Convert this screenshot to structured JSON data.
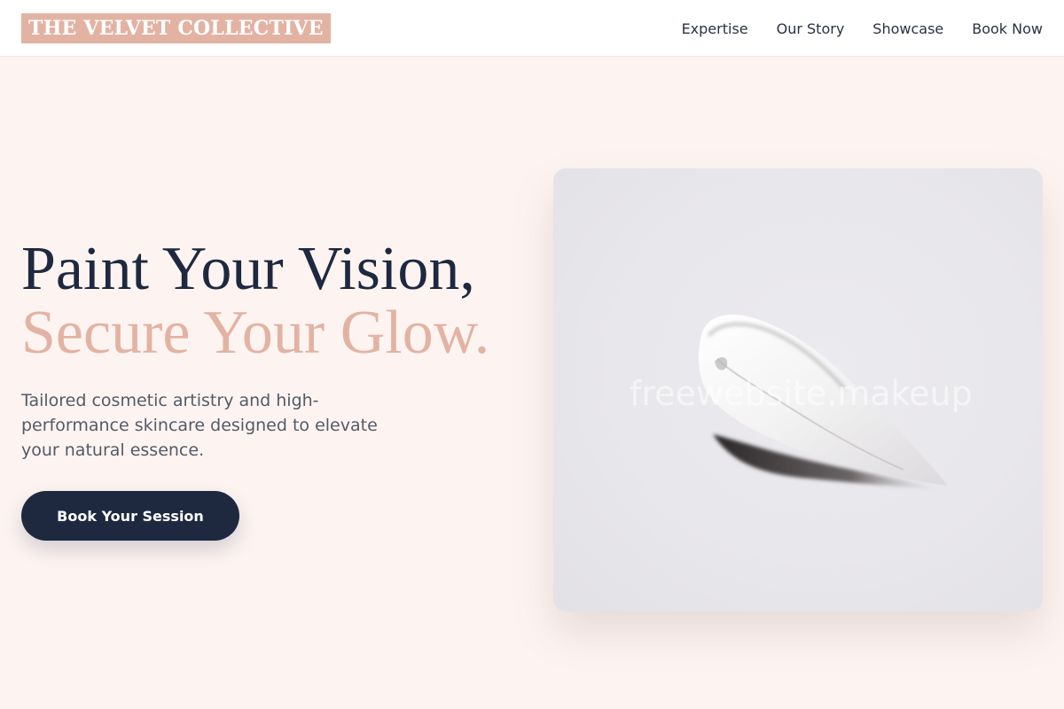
{
  "header": {
    "brand": "THE VELVET COLLECTIVE",
    "nav": [
      {
        "label": "Expertise"
      },
      {
        "label": "Our Story"
      },
      {
        "label": "Showcase"
      },
      {
        "label": "Book Now"
      }
    ]
  },
  "hero": {
    "headline_line1": "Paint Your Vision,",
    "headline_line2": "Secure Your Glow.",
    "subtitle": "Tailored cosmetic artistry and high-performance skincare designed to elevate your natural essence.",
    "cta_label": "Book Your Session",
    "image": {
      "watermark": "freewebsite.makeup"
    }
  },
  "colors": {
    "page_background": "#fdf4f1",
    "accent_blush": "#e2b3a3",
    "navy": "#1e2940",
    "body_text": "#545a66",
    "header_background": "#ffffff"
  }
}
